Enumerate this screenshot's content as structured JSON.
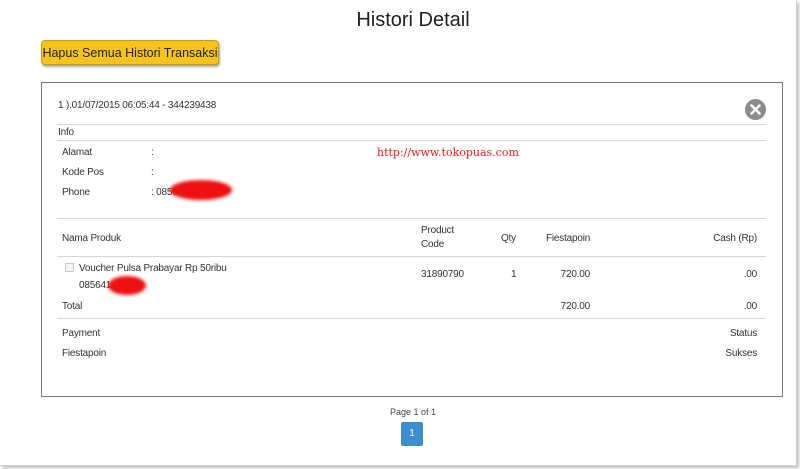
{
  "page": {
    "title": "Histori Detail"
  },
  "actions": {
    "clear_history_label": "Hapus Semua Histori Transaksi"
  },
  "transaction": {
    "header": "1 ).01/07/2015 06:05:44 - 344239438",
    "close_icon": "close-circle-icon",
    "info_heading": "Info",
    "fields": [
      {
        "label": "Alamat",
        "value": ":"
      },
      {
        "label": "Kode Pos",
        "value": ":"
      },
      {
        "label": "Phone",
        "value": ": 0856"
      }
    ],
    "watermark": "http://www.tokopuas.com",
    "table": {
      "headers": {
        "product_name": "Nama Produk",
        "product_code_line1": "Product",
        "product_code_line2": "Code",
        "qty": "Qty",
        "fiestapoin": "Fiestapoin",
        "cash": "Cash (Rp)"
      },
      "rows": [
        {
          "name": "Voucher Pulsa Prabayar Rp 50ribu",
          "number": "085641",
          "code": "31890790",
          "qty": "1",
          "fiestapoin": "720.00",
          "cash": ".00"
        }
      ],
      "total": {
        "label": "Total",
        "fiestapoin": "720.00",
        "cash": ".00"
      }
    },
    "payment": {
      "label": "Payment",
      "status_label": "Status",
      "method": "Fiestapoin",
      "status": "Sukses"
    }
  },
  "pagination": {
    "info": "Page 1 of 1",
    "current": "1"
  },
  "colors": {
    "button": "#f5c31e",
    "page_active": "#3b8ed0",
    "redaction": "#ee1111",
    "watermark": "#e02020"
  }
}
